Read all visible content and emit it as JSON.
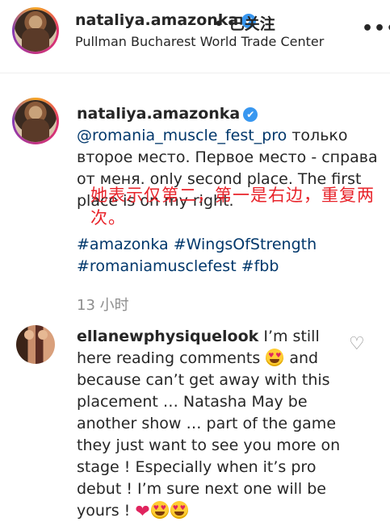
{
  "header": {
    "username": "nataliya.amazonka",
    "verified_icon": "✔",
    "follow_state": "• 已关注",
    "location": "Pullman Bucharest World Trade Center",
    "more_icon": "•••"
  },
  "caption": {
    "username": "nataliya.amazonka",
    "verified_icon": "✔",
    "mention": "@romania_muscle_fest_pro",
    "text": " только второе место. Первое место - справа от меня. only second place. The first place is on my right.",
    "overlay_note": "她表示仅第二，第一是右边，重复两次。",
    "hashtags": [
      "#amazonka",
      "#WingsOfStrength",
      "#romaniamusclefest",
      "#fbb"
    ],
    "timestamp": "13 小时"
  },
  "comment": {
    "username": "ellanewphysiquelook",
    "text_1": " I’m still here reading comments ",
    "text_2": " and because can’t get away with this placement … Natasha May be another show … part of the game they just want to see you more on stage ! Especially when it’s pro debut ! I’m sure next one will be yours ! ",
    "emojis": [
      "heart-eyes-emoji",
      "red-heart-emoji",
      "heart-eyes-emoji",
      "heart-eyes-emoji"
    ],
    "like_icon": "♡"
  },
  "colors": {
    "link": "#00376b",
    "verified": "#3897f0",
    "overlay_text": "#e8232a",
    "muted": "#8e8e8e"
  }
}
